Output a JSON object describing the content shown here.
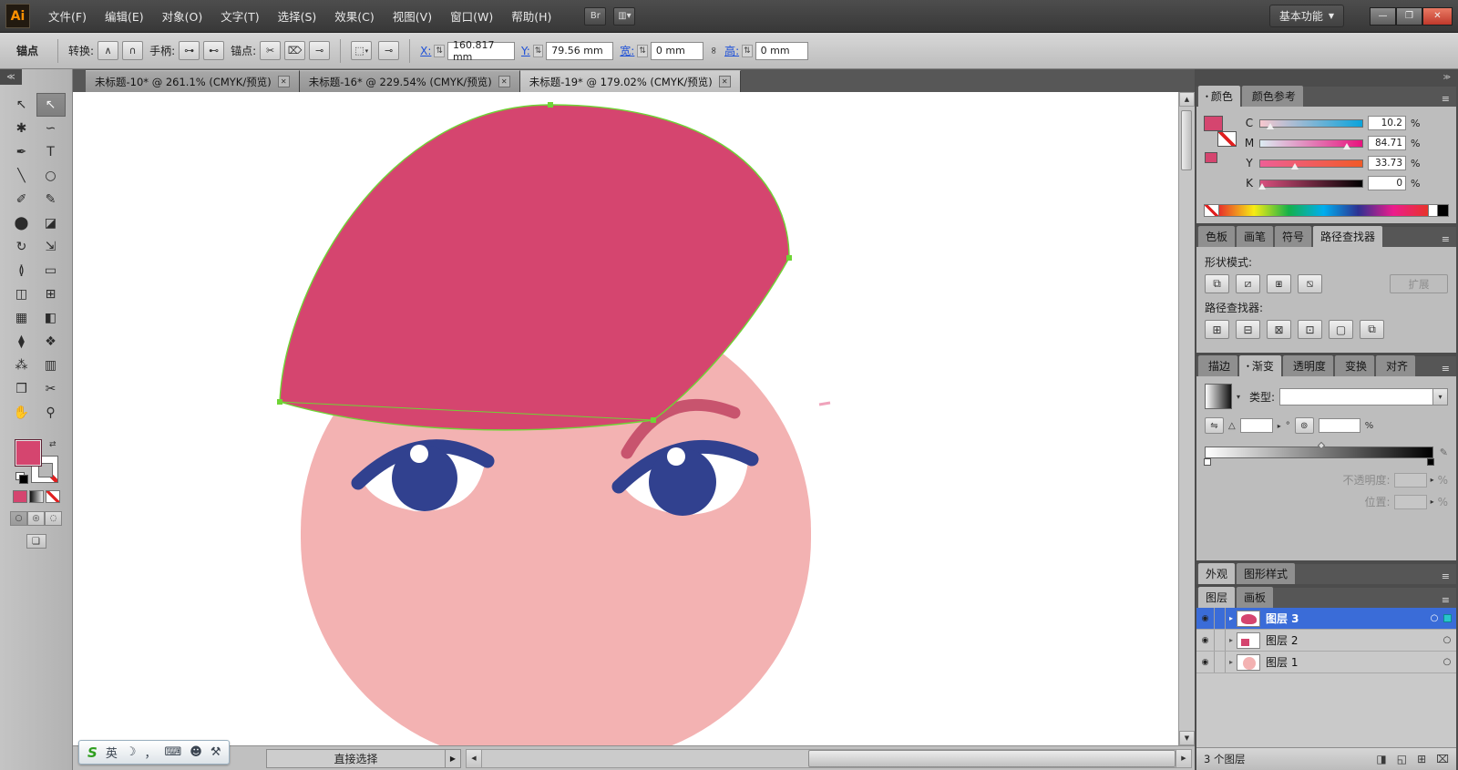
{
  "colors": {
    "hair": "#d5456f",
    "face": "#f3b2b2",
    "eye": "#31418f",
    "brow": "#c8546e",
    "selection": "#6fd435",
    "layer_active": "#3a6cd8"
  },
  "titlebar": {
    "logo": "Ai",
    "menus": [
      {
        "name": "menu-file",
        "label": "文件(F)"
      },
      {
        "name": "menu-edit",
        "label": "编辑(E)"
      },
      {
        "name": "menu-object",
        "label": "对象(O)"
      },
      {
        "name": "menu-type",
        "label": "文字(T)"
      },
      {
        "name": "menu-select",
        "label": "选择(S)"
      },
      {
        "name": "menu-effect",
        "label": "效果(C)"
      },
      {
        "name": "menu-view",
        "label": "视图(V)"
      },
      {
        "name": "menu-window",
        "label": "窗口(W)"
      },
      {
        "name": "menu-help",
        "label": "帮助(H)"
      }
    ],
    "bridge_glyph": "Br",
    "arrange_glyph": "▥",
    "arrange_arrow": "▾",
    "workspace_label": "基本功能",
    "workspace_arrow": "▼",
    "minimize_glyph": "—",
    "maximize_glyph": "❐",
    "close_glyph": "✕"
  },
  "control_bar": {
    "tool_label": "锚点",
    "convert_label": "转换:",
    "convert_buttons": [
      {
        "name": "convert-to-corner-button",
        "glyph": "∧"
      },
      {
        "name": "convert-to-smooth-button",
        "glyph": "∩"
      }
    ],
    "handles_label": "手柄:",
    "handle_buttons": [
      {
        "name": "show-handles-button",
        "glyph": "⊶"
      },
      {
        "name": "hide-handles-button",
        "glyph": "⊷"
      }
    ],
    "anchors_label": "锚点:",
    "anchor_buttons": [
      {
        "name": "cut-path-button",
        "glyph": "✂"
      },
      {
        "name": "delete-anchor-button",
        "glyph": "⌦"
      },
      {
        "name": "connect-path-button",
        "glyph": "⊸"
      }
    ],
    "extra_buttons": [
      {
        "name": "select-similar-button",
        "glyph": "⬚"
      },
      {
        "name": "isolate-selection-button",
        "glyph": "⊸"
      }
    ],
    "dropdown_arrow": "▾",
    "stepper_glyph": "⇅",
    "fields": [
      {
        "name": "x-field",
        "label": "X:",
        "value": "160.817 mm"
      },
      {
        "name": "y-field",
        "label": "Y:",
        "value": "79.56 mm"
      },
      {
        "name": "width-field",
        "label": "宽:",
        "value": "0 mm"
      },
      {
        "name": "height-field",
        "label": "高:",
        "value": "0 mm"
      }
    ],
    "link_glyph": "∞"
  },
  "document_tabs": [
    {
      "name": "doc-tab-1",
      "title": "未标题-10* @ 261.1% (CMYK/预览)",
      "close": "✕"
    },
    {
      "name": "doc-tab-2",
      "title": "未标题-16* @ 229.54% (CMYK/预览)",
      "close": "✕"
    },
    {
      "name": "doc-tab-3",
      "title": "未标题-19* @ 179.02% (CMYK/预览)",
      "close": "✕",
      "active": true
    }
  ],
  "toolbar": {
    "collapse_glyph": "≪",
    "tools": [
      {
        "name": "selection-tool",
        "glyph": "↖"
      },
      {
        "name": "direct-selection-tool",
        "glyph": "↖",
        "active": true
      },
      {
        "name": "magic-wand-tool",
        "glyph": "✱"
      },
      {
        "name": "lasso-tool",
        "glyph": "∽"
      },
      {
        "name": "pen-tool",
        "glyph": "✒"
      },
      {
        "name": "type-tool",
        "glyph": "T"
      },
      {
        "name": "line-segment-tool",
        "glyph": "╲"
      },
      {
        "name": "ellipse-tool",
        "glyph": "○"
      },
      {
        "name": "paintbrush-tool",
        "glyph": "✐"
      },
      {
        "name": "pencil-tool",
        "glyph": "✎"
      },
      {
        "name": "blob-brush-tool",
        "glyph": "⬤"
      },
      {
        "name": "eraser-tool",
        "glyph": "◪"
      },
      {
        "name": "rotate-tool",
        "glyph": "↻"
      },
      {
        "name": "scale-tool",
        "glyph": "⇲"
      },
      {
        "name": "width-tool",
        "glyph": "≬"
      },
      {
        "name": "free-transform-tool",
        "glyph": "▭"
      },
      {
        "name": "shape-builder-tool",
        "glyph": "◫"
      },
      {
        "name": "perspective-grid-tool",
        "glyph": "⊞"
      },
      {
        "name": "mesh-tool",
        "glyph": "▦"
      },
      {
        "name": "gradient-tool",
        "glyph": "◧"
      },
      {
        "name": "eyedropper-tool",
        "glyph": "⧫"
      },
      {
        "name": "blend-tool",
        "glyph": "❖"
      },
      {
        "name": "symbol-sprayer-tool",
        "glyph": "⁂"
      },
      {
        "name": "column-graph-tool",
        "glyph": "▥"
      },
      {
        "name": "artboard-tool",
        "glyph": "❒"
      },
      {
        "name": "slice-tool",
        "glyph": "✂"
      },
      {
        "name": "hand-tool",
        "glyph": "✋"
      },
      {
        "name": "zoom-tool",
        "glyph": "⚲"
      }
    ],
    "swap_glyph": "⇄",
    "color_buttons": [
      {
        "name": "fill-color-button",
        "cls": "ct-color"
      },
      {
        "name": "gradient-fill-button",
        "cls": "ct-grad"
      },
      {
        "name": "none-fill-button",
        "cls": "ct-none"
      }
    ],
    "draw_modes": [
      {
        "name": "draw-normal-button",
        "glyph": "○"
      },
      {
        "name": "draw-behind-button",
        "glyph": "◎"
      },
      {
        "name": "draw-inside-button",
        "glyph": "◌"
      }
    ],
    "screen_mode_glyph": "❏"
  },
  "panels": {
    "dock_collapse_glyph": "≫",
    "menu_glyph": "≡",
    "color_tabs": [
      {
        "name": "tab-color",
        "pre": "⬩",
        "label": "颜色",
        "active": true
      },
      {
        "name": "tab-color-guide",
        "label": "颜色参考"
      }
    ],
    "pf_tabs": [
      {
        "name": "tab-swatches",
        "label": "色板"
      },
      {
        "name": "tab-brushes",
        "label": "画笔"
      },
      {
        "name": "tab-symbols",
        "label": "符号"
      },
      {
        "name": "tab-pathfinder",
        "label": "路径查找器",
        "active": true
      }
    ],
    "grad_tabs": [
      {
        "name": "tab-stroke",
        "label": "描边"
      },
      {
        "name": "tab-gradient",
        "pre": "⬩",
        "label": "渐变",
        "active": true
      },
      {
        "name": "tab-transparency",
        "label": "透明度"
      },
      {
        "name": "tab-transform",
        "label": "变换"
      },
      {
        "name": "tab-align",
        "label": "对齐"
      }
    ],
    "app_tabs": [
      {
        "name": "tab-appearance",
        "label": "外观",
        "active": true
      },
      {
        "name": "tab-graphic-styles",
        "label": "图形样式"
      }
    ],
    "layer_tabs": [
      {
        "name": "tab-layers",
        "label": "图层",
        "active": true
      },
      {
        "name": "tab-artboards",
        "label": "画板"
      }
    ]
  },
  "color_panel": {
    "channels": [
      {
        "name": "cyan-slider",
        "label": "C",
        "value": "10.2",
        "unit": "%",
        "cls": "ch-c"
      },
      {
        "name": "magenta-slider",
        "label": "M",
        "value": "84.71",
        "unit": "%",
        "cls": "ch-m"
      },
      {
        "name": "yellow-slider",
        "label": "Y",
        "value": "33.73",
        "unit": "%",
        "cls": "ch-y"
      },
      {
        "name": "black-slider",
        "label": "K",
        "value": "0",
        "unit": "%",
        "cls": "ch-k"
      }
    ]
  },
  "pathfinder_panel": {
    "shape_modes_label": "形状模式:",
    "shape_buttons": [
      {
        "name": "unite-button",
        "glyph": "⧉"
      },
      {
        "name": "minus-front-button",
        "glyph": "⧄"
      },
      {
        "name": "intersect-button",
        "glyph": "⧆"
      },
      {
        "name": "exclude-button",
        "glyph": "⧅"
      }
    ],
    "expand_label": "扩展",
    "pathfinders_label": "路径查找器:",
    "pathfinder_buttons": [
      {
        "name": "divide-button",
        "glyph": "⊞"
      },
      {
        "name": "trim-button",
        "glyph": "⊟"
      },
      {
        "name": "merge-button",
        "glyph": "⊠"
      },
      {
        "name": "crop-button",
        "glyph": "⊡"
      },
      {
        "name": "outline-button",
        "glyph": "▢"
      },
      {
        "name": "minus-back-button",
        "glyph": "⧉"
      }
    ]
  },
  "gradient_panel": {
    "type_label": "类型:",
    "combo_arrow": "▾",
    "reverse_glyph": "⇋",
    "angle_glyph": "△",
    "chevron": "▸",
    "degree": "°",
    "aspect_glyph": "⊚",
    "unit": "%",
    "side_glyph": "✎",
    "opacity_label": "不透明度:",
    "location_label": "位置:"
  },
  "layers": {
    "rows": [
      {
        "name": "layer-row-3",
        "label": "图层 3",
        "eye": "◉",
        "arrow": "▸",
        "target": "○",
        "cls": "thumb-hair",
        "active": true
      },
      {
        "name": "layer-row-2",
        "label": "图层 2",
        "eye": "◉",
        "arrow": "▸",
        "target": "○",
        "cls": "thumb-chip"
      },
      {
        "name": "layer-row-1",
        "label": "图层 1",
        "eye": "◉",
        "arrow": "▸",
        "target": "○",
        "cls": "thumb-face"
      }
    ],
    "status": "3 个图层",
    "buttons": [
      {
        "name": "make-clipping-mask-button",
        "glyph": "◨"
      },
      {
        "name": "new-sublayer-button",
        "glyph": "◱"
      },
      {
        "name": "new-layer-button",
        "glyph": "⊞"
      },
      {
        "name": "delete-layer-button",
        "glyph": "⌧"
      }
    ]
  },
  "status_bar": {
    "tool_label": "直接选择",
    "arrow": "▶"
  },
  "ime": {
    "icons": [
      {
        "name": "sogou-logo",
        "glyph": "S",
        "cls": "sogou"
      },
      {
        "name": "lang-toggle",
        "glyph": "英"
      },
      {
        "name": "moon-icon",
        "glyph": "☽"
      },
      {
        "name": "punct-icon",
        "glyph": "，"
      },
      {
        "name": "keyboard-icon",
        "glyph": "⌨"
      },
      {
        "name": "user-icon",
        "glyph": "☻"
      },
      {
        "name": "wrench-icon",
        "glyph": "⚒"
      }
    ]
  },
  "scroll": {
    "up": "▲",
    "down": "▼",
    "left": "◀",
    "right": "▶"
  }
}
